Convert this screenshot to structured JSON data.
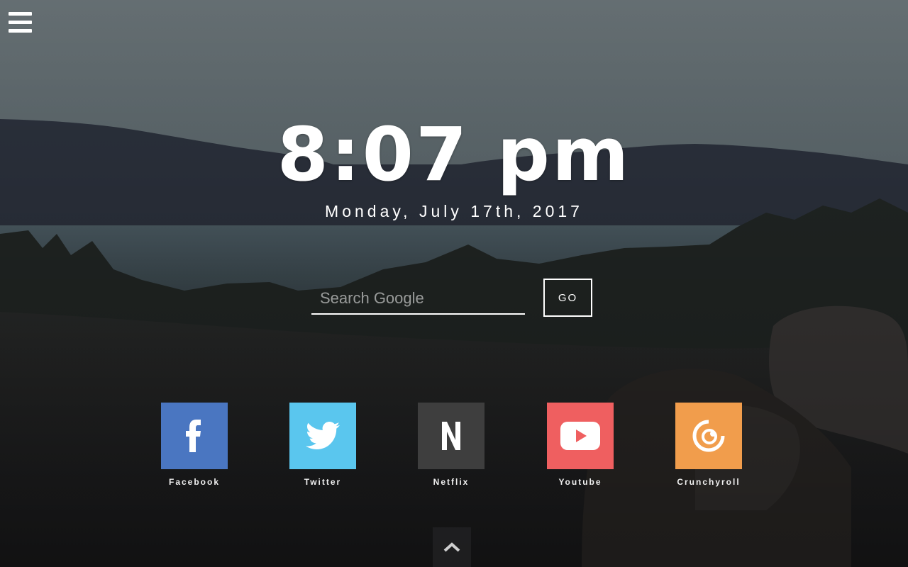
{
  "menu": {
    "icon": "hamburger-menu-icon"
  },
  "clock": {
    "time": "8:07 pm",
    "date": "Monday, July 17th, 2017"
  },
  "search": {
    "placeholder": "Search Google",
    "value": "",
    "button_label": "GO"
  },
  "shortcuts": [
    {
      "label": "Facebook",
      "icon": "facebook-icon",
      "color": "#4a76c1"
    },
    {
      "label": "Twitter",
      "icon": "twitter-icon",
      "color": "#5ac6ee"
    },
    {
      "label": "Netflix",
      "icon": "netflix-icon",
      "color": "#3e3e3e"
    },
    {
      "label": "Youtube",
      "icon": "youtube-icon",
      "color": "#ef5f60"
    },
    {
      "label": "Crunchyroll",
      "icon": "crunchyroll-icon",
      "color": "#f19d4c"
    }
  ],
  "footer": {
    "icon": "chevron-up-icon"
  }
}
